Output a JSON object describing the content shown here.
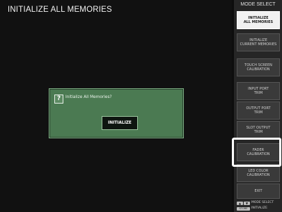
{
  "screen": {
    "title": "INITIALIZE ALL MEMORIES"
  },
  "dialog": {
    "message": "Initialize All Memories?",
    "button_label": "INITIALIZE",
    "icon_glyph": "?"
  },
  "sidebar": {
    "title": "MODE SELECT",
    "buttons": [
      {
        "label": "INITIALIZE\nALL MEMORIES",
        "selected": true
      },
      {
        "label": "INITIALIZE\nCURRENT MEMORIES"
      },
      {
        "label": "TOUCH SCREEN\nCALIBRATION"
      },
      {
        "label": "INPUT PORT\nTRIM"
      },
      {
        "label": "OUTPUT PORT\nTRIM"
      },
      {
        "label": "SLOT OUTPUT\nTRIM"
      },
      {
        "label": "FADER\nCALIBRATION"
      },
      {
        "label": "LED COLOR\nCALIBRATION"
      },
      {
        "label": "EXIT"
      }
    ]
  },
  "footer": {
    "arrow_keys": [
      "▲",
      "▼"
    ],
    "mode_select_label": "MODE SELECT",
    "store_key": "STORE",
    "initialize_label": "INITIALIZE"
  },
  "colors": {
    "dialog_green": "#4b7a52",
    "selected_button": "#f1f1f1",
    "highlight": "#ffffff"
  }
}
